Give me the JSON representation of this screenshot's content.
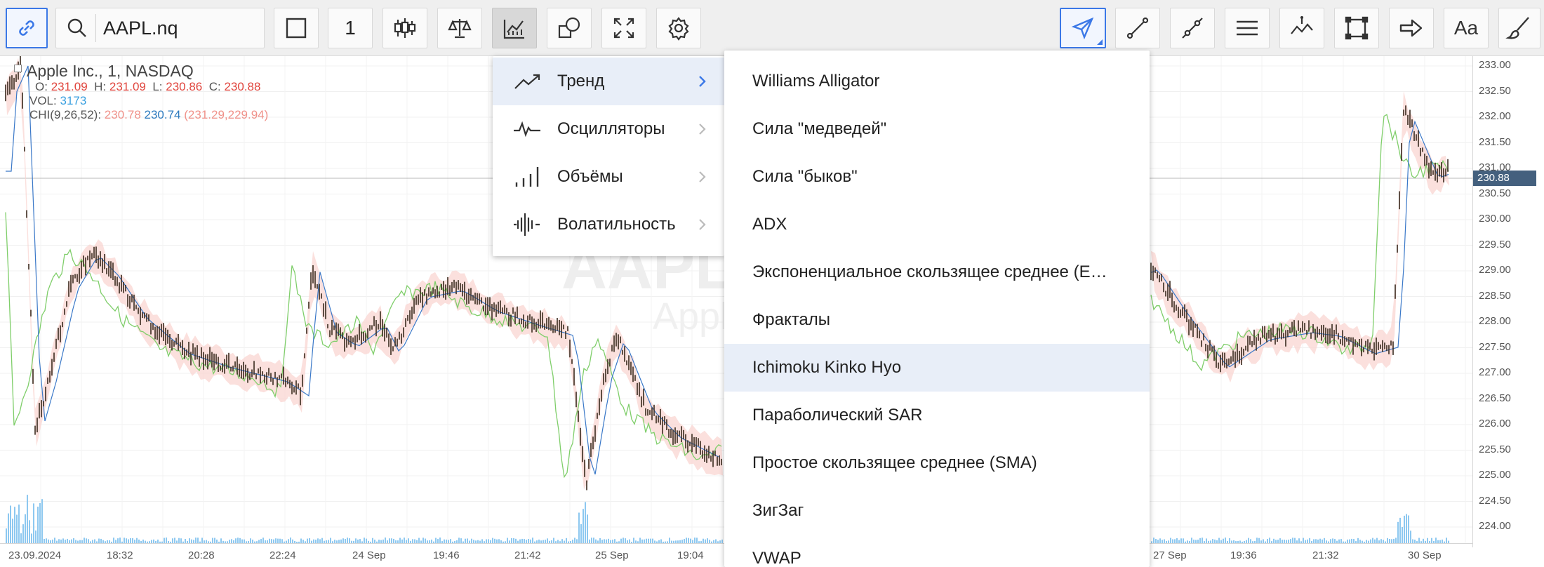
{
  "toolbar": {
    "search": {
      "value": "AAPL.nq",
      "placeholder": ""
    },
    "interval_label": "1",
    "font_button_label": "Aa",
    "icons": [
      "link-icon",
      "search-icon",
      "square-icon",
      "candlestick-icon",
      "scales-icon",
      "indicator-icon",
      "shapes-icon",
      "fullscreen-icon",
      "gear-icon",
      "cursor-arrow-icon",
      "line-icon",
      "segment-line-icon",
      "horizontal-lines-icon",
      "annotation-icon",
      "rectangle-icon",
      "arrow-icon",
      "text-icon",
      "brush-icon"
    ]
  },
  "legend": {
    "title": "Apple Inc.,  1,  NASDAQ",
    "ohlc": {
      "o_label": "O:",
      "o": "231.09",
      "h_label": "H:",
      "h": "231.09",
      "l_label": "L:",
      "l": "230.86",
      "c_label": "C:",
      "c": "230.88"
    },
    "vol_label": "VOL:",
    "vol": "3173",
    "ichimoku_label": "CHI(9,26,52):",
    "ich1": "230.78",
    "ich2": "230.74",
    "ich3": "(231.29,229.94)"
  },
  "watermark": {
    "symbol": "AAPL",
    "name": "Apple"
  },
  "price_axis": {
    "labels": [
      "233.00",
      "232.50",
      "232.00",
      "231.50",
      "231.00",
      "230.50",
      "230.00",
      "229.50",
      "229.00",
      "228.50",
      "228.00",
      "227.50",
      "227.00",
      "226.50",
      "226.00",
      "225.50",
      "225.00",
      "224.50",
      "224.00"
    ],
    "current": "230.88"
  },
  "time_axis": {
    "labels": [
      "23.09.2024",
      "18:32",
      "20:28",
      "22:24",
      "24 Sep",
      "19:46",
      "21:42",
      "25 Sep",
      "19:04",
      "27 Sep",
      "19:36",
      "21:32",
      "30 Sep"
    ]
  },
  "indicator_menu": {
    "categories": [
      {
        "label": "Тренд",
        "icon": "trend-icon"
      },
      {
        "label": "Осцилляторы",
        "icon": "oscillator-icon"
      },
      {
        "label": "Объёмы",
        "icon": "volume-icon"
      },
      {
        "label": "Волатильность",
        "icon": "volatility-icon"
      }
    ],
    "selected_category": "Тренд",
    "items": [
      "Williams Alligator",
      "Сила \"медведей\"",
      "Сила \"быков\"",
      "ADX",
      "Экспоненциальное скользящее среднее (EMA)",
      "Фракталы",
      "Ichimoku Kinko Hyo",
      "Параболический SAR",
      "Простое скользящее среднее (SMA)",
      "ЗигЗаг",
      "VWAP"
    ],
    "highlighted_item": "Ichimoku Kinko Hyo"
  },
  "colors": {
    "accent": "#3b78e7",
    "candle": "#3a2a1e",
    "cloud_green": "#d9f2d0",
    "cloud_red": "#f9d5d2",
    "kijun": "#3a78c8",
    "chikou": "#7fce6a",
    "volume": "#8dc8f0",
    "price_badge": "#44607e"
  }
}
